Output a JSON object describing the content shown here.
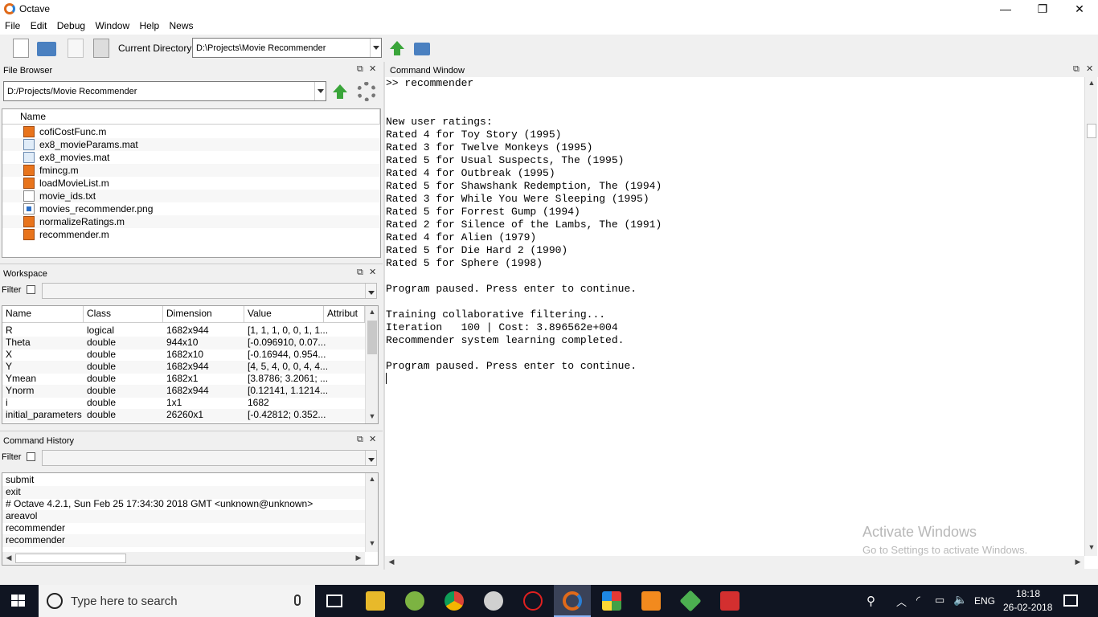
{
  "window": {
    "title": "Octave",
    "minimize": "—",
    "restore": "❐",
    "close": "✕"
  },
  "menu": [
    "File",
    "Edit",
    "Debug",
    "Window",
    "Help",
    "News"
  ],
  "toolbar": {
    "current_directory_label": "Current Directory:",
    "current_directory_value": "D:\\Projects\\Movie Recommender"
  },
  "file_browser": {
    "title": "File Browser",
    "path": "D:/Projects/Movie Recommender",
    "column": "Name",
    "files": [
      {
        "name": "cofiCostFunc.m",
        "icon": "m-file-icon"
      },
      {
        "name": "ex8_movieParams.mat",
        "icon": "mat-file-icon"
      },
      {
        "name": "ex8_movies.mat",
        "icon": "mat-file-icon"
      },
      {
        "name": "fmincg.m",
        "icon": "m-file-icon"
      },
      {
        "name": "loadMovieList.m",
        "icon": "m-file-icon"
      },
      {
        "name": "movie_ids.txt",
        "icon": "txt-file-icon"
      },
      {
        "name": "movies_recommender.png",
        "icon": "png-file-icon"
      },
      {
        "name": "normalizeRatings.m",
        "icon": "m-file-icon"
      },
      {
        "name": "recommender.m",
        "icon": "m-file-icon"
      }
    ]
  },
  "workspace": {
    "title": "Workspace",
    "filter_label": "Filter",
    "columns": [
      "Name",
      "Class",
      "Dimension",
      "Value",
      "Attribut"
    ],
    "rows": [
      [
        "R",
        "logical",
        "1682x944",
        "[1, 1, 1, 0, 0, 1, 1..."
      ],
      [
        "Theta",
        "double",
        "944x10",
        "[-0.096910, 0.07..."
      ],
      [
        "X",
        "double",
        "1682x10",
        "[-0.16944, 0.954..."
      ],
      [
        "Y",
        "double",
        "1682x944",
        "[4, 5, 4, 0, 0, 4, 4..."
      ],
      [
        "Ymean",
        "double",
        "1682x1",
        "[3.8786; 3.2061; ..."
      ],
      [
        "Ynorm",
        "double",
        "1682x944",
        "[0.12141, 1.1214..."
      ],
      [
        "i",
        "double",
        "1x1",
        "1682"
      ],
      [
        "initial_parameters",
        "double",
        "26260x1",
        "[-0.42812; 0.352..."
      ]
    ]
  },
  "command_history": {
    "title": "Command History",
    "filter_label": "Filter",
    "entries": [
      "submit",
      "exit",
      "# Octave 4.2.1, Sun Feb 25 17:34:30 2018 GMT <unknown@unknown>",
      "areavol",
      "recommender",
      "recommender"
    ]
  },
  "command_window": {
    "title": "Command Window",
    "lines": [
      ">> recommender",
      "",
      "",
      "New user ratings:",
      "Rated 4 for Toy Story (1995)",
      "Rated 3 for Twelve Monkeys (1995)",
      "Rated 5 for Usual Suspects, The (1995)",
      "Rated 4 for Outbreak (1995)",
      "Rated 5 for Shawshank Redemption, The (1994)",
      "Rated 3 for While You Were Sleeping (1995)",
      "Rated 5 for Forrest Gump (1994)",
      "Rated 2 for Silence of the Lambs, The (1991)",
      "Rated 4 for Alien (1979)",
      "Rated 5 for Die Hard 2 (1990)",
      "Rated 5 for Sphere (1998)",
      "",
      "Program paused. Press enter to continue.",
      "",
      "Training collaborative filtering...",
      "Iteration   100 | Cost: 3.896562e+004",
      "Recommender system learning completed.",
      "",
      "Program paused. Press enter to continue."
    ]
  },
  "watermark": {
    "line1": "Activate Windows",
    "line2": "Go to Settings to activate Windows."
  },
  "taskbar": {
    "search_placeholder": "Type here to search",
    "language": "ENG",
    "time": "18:18",
    "date": "26-02-2018"
  }
}
